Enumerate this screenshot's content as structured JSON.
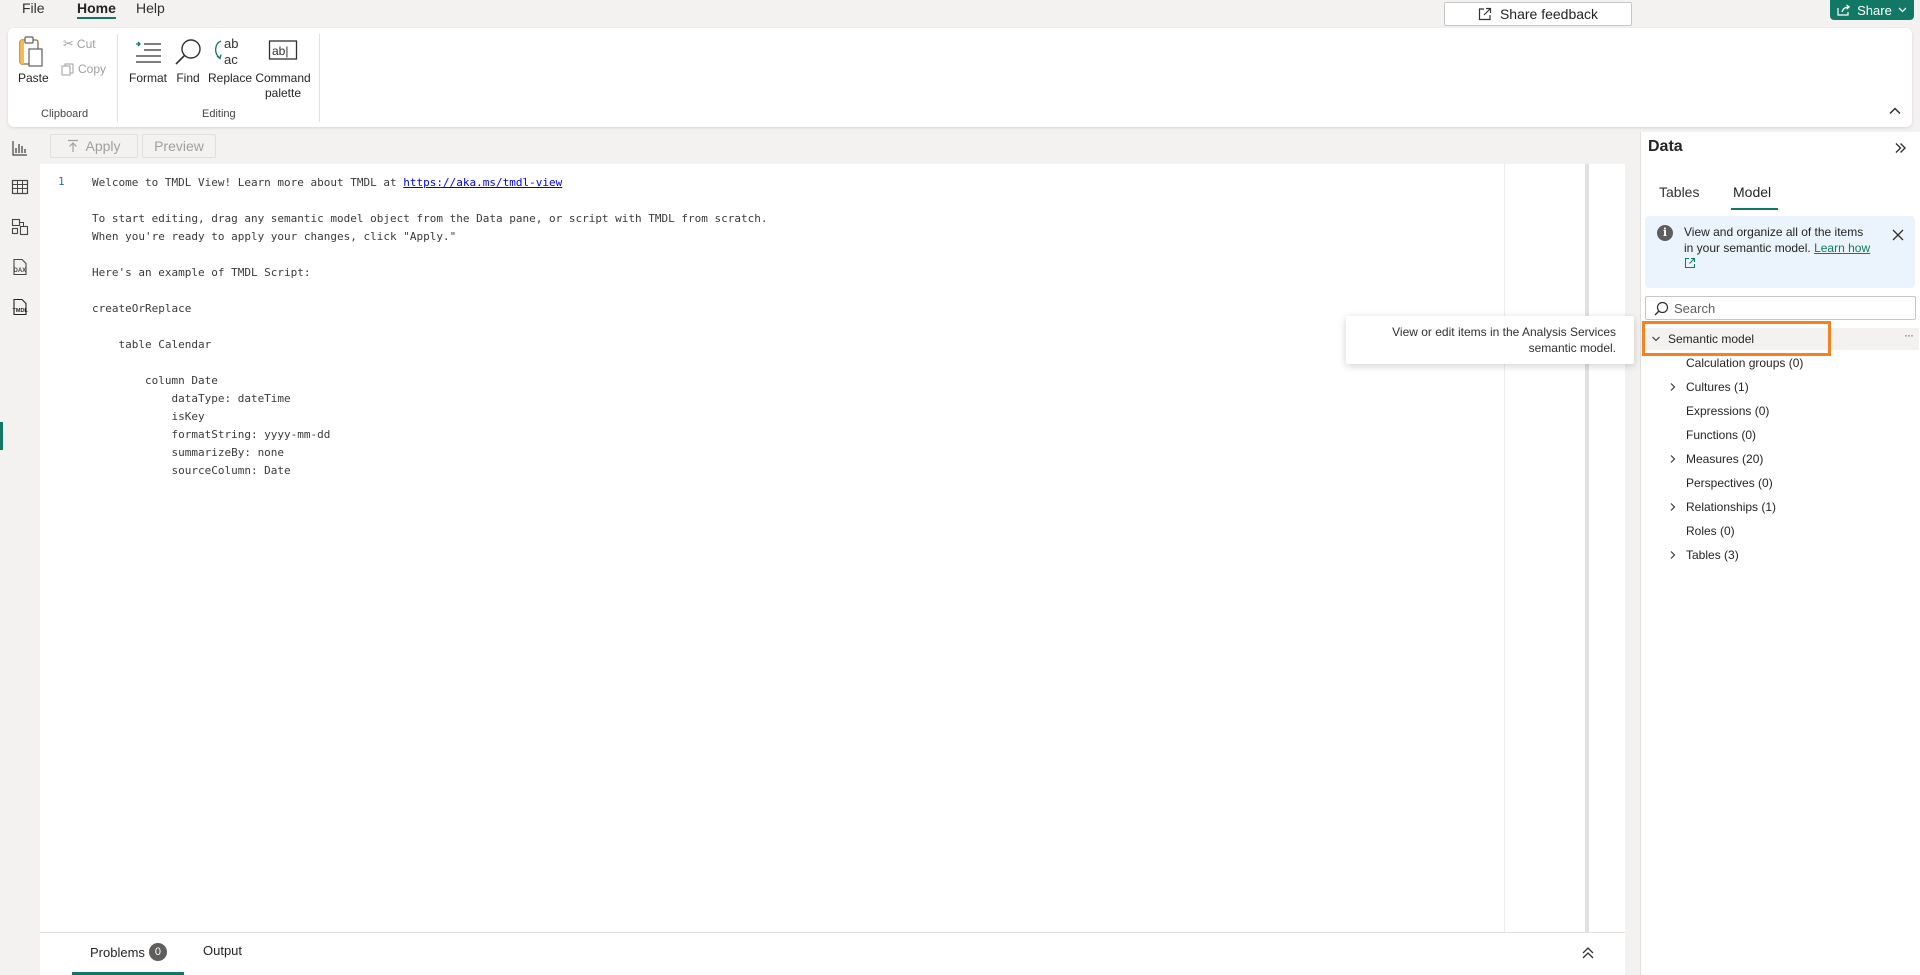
{
  "menu": {
    "file": "File",
    "home": "Home",
    "help": "Help",
    "share": "Share"
  },
  "ribbon": {
    "paste": "Paste",
    "cut": "Cut",
    "copy": "Copy",
    "clipboard_group": "Clipboard",
    "format": "Format",
    "find": "Find",
    "replace": "Replace",
    "command_palette_1": "Command",
    "command_palette_2": "palette",
    "editing_group": "Editing"
  },
  "toolbar": {
    "apply": "Apply",
    "preview": "Preview",
    "share_feedback": "Share feedback"
  },
  "editor": {
    "line_number": "1",
    "lines": [
      "Welcome to TMDL View! Learn more about TMDL at ",
      "To start editing, drag any semantic model object from the Data pane, or script with TMDL from scratch.",
      "When you're ready to apply your changes, click \"Apply.\"",
      "Here's an example of TMDL Script:",
      "createOrReplace",
      "    table Calendar",
      "        column Date",
      "            dataType: dateTime",
      "            isKey",
      "            formatString: yyyy-mm-dd",
      "            summarizeBy: none",
      "            sourceColumn: Date"
    ],
    "link": "https://aka.ms/tmdl-view"
  },
  "bottom": {
    "problems": "Problems",
    "problems_count": "0",
    "output": "Output"
  },
  "data_pane": {
    "title": "Data",
    "tab_tables": "Tables",
    "tab_model": "Model",
    "info_text": "View and organize all of the items in your semantic model.",
    "learn_how": "Learn how",
    "search_placeholder": "Search",
    "root": "Semantic model",
    "items": [
      {
        "label": "Calculation groups (0)",
        "expandable": false
      },
      {
        "label": "Cultures (1)",
        "expandable": true
      },
      {
        "label": "Expressions (0)",
        "expandable": false
      },
      {
        "label": "Functions (0)",
        "expandable": false
      },
      {
        "label": "Measures (20)",
        "expandable": true
      },
      {
        "label": "Perspectives (0)",
        "expandable": false
      },
      {
        "label": "Relationships (1)",
        "expandable": true
      },
      {
        "label": "Roles (0)",
        "expandable": false
      },
      {
        "label": "Tables (3)",
        "expandable": true
      }
    ]
  },
  "tooltip": {
    "text": "View or edit items in the Analysis Services semantic model."
  },
  "colors": {
    "accent": "#117865",
    "highlight": "#f5821f",
    "link": "#0000ee"
  }
}
